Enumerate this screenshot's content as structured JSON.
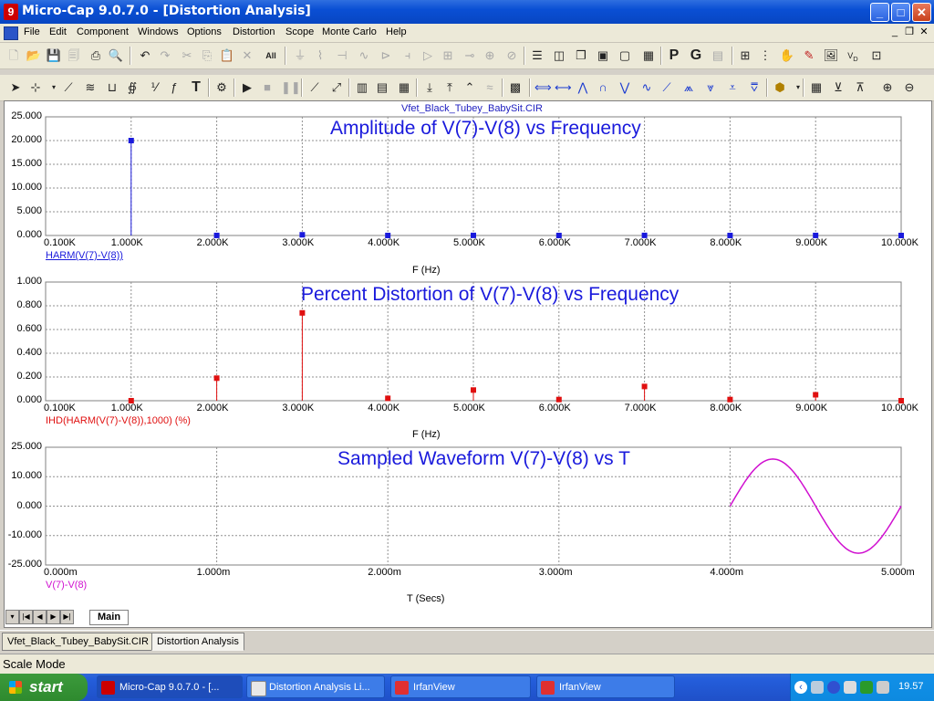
{
  "window": {
    "title": "Micro-Cap 9.0.7.0 - [Distortion Analysis]",
    "min": "_",
    "max": "□",
    "close": "✕"
  },
  "menu": [
    "File",
    "Edit",
    "Component",
    "Windows",
    "Options",
    "Distortion",
    "Scope",
    "Monte Carlo",
    "Help"
  ],
  "circuit_name": "Vfet_Black_Tubey_BabySit.CIR",
  "plots": [
    {
      "title": "Amplitude of V(7)-V(8) vs Frequency",
      "expression": "HARM(V(7)-V(8))",
      "expression_color": "#1a1adc",
      "xlabel": "F (Hz)",
      "y_ticks": [
        "25.000",
        "20.000",
        "15.000",
        "10.000",
        "5.000",
        "0.000"
      ],
      "x_ticks": [
        "0.100K",
        "1.000K",
        "2.000K",
        "3.000K",
        "4.000K",
        "5.000K",
        "6.000K",
        "7.000K",
        "8.000K",
        "9.000K",
        "10.000K"
      ]
    },
    {
      "title": "Percent Distortion of V(7)-V(8) vs Frequency",
      "expression": "IHD(HARM(V(7)-V(8)),1000) (%)",
      "expression_color": "#e01010",
      "xlabel": "F (Hz)",
      "y_ticks": [
        "1.000",
        "0.800",
        "0.600",
        "0.400",
        "0.200",
        "0.000"
      ],
      "x_ticks": [
        "0.100K",
        "1.000K",
        "2.000K",
        "3.000K",
        "4.000K",
        "5.000K",
        "6.000K",
        "7.000K",
        "8.000K",
        "9.000K",
        "10.000K"
      ]
    },
    {
      "title": "Sampled Waveform  V(7)-V(8) vs T",
      "expression": "V(7)-V(8)",
      "expression_color": "#d010d0",
      "xlabel": "T (Secs)",
      "y_ticks": [
        "25.000",
        "10.000",
        "0.000",
        "-10.000",
        "-25.000"
      ],
      "x_ticks": [
        "0.000m",
        "1.000m",
        "2.000m",
        "3.000m",
        "4.000m",
        "5.000m"
      ]
    }
  ],
  "chart_data": [
    {
      "type": "bar",
      "x": [
        1000,
        2000,
        3000,
        4000,
        5000,
        6000,
        7000,
        8000,
        9000,
        10000
      ],
      "values": [
        20.0,
        0.01,
        0.15,
        0.005,
        0.02,
        0.003,
        0.02,
        0.002,
        0.01,
        0.0
      ],
      "xlim": [
        0,
        10000
      ],
      "ylim": [
        0,
        25
      ],
      "color": "#1a1adc"
    },
    {
      "type": "bar",
      "x": [
        1000,
        2000,
        3000,
        4000,
        5000,
        6000,
        7000,
        8000,
        9000,
        10000
      ],
      "values": [
        0.0,
        0.19,
        0.74,
        0.02,
        0.09,
        0.01,
        0.12,
        0.01,
        0.05,
        0.0
      ],
      "xlim": [
        0,
        10000
      ],
      "ylim": [
        0,
        1
      ],
      "color": "#e01010"
    },
    {
      "type": "line",
      "x_units": "ms",
      "x": [
        4.0,
        4.1,
        4.2,
        4.25,
        4.3,
        4.4,
        4.5,
        4.6,
        4.7,
        4.75,
        4.8,
        4.9,
        5.0
      ],
      "values": [
        0.0,
        11.8,
        19.0,
        20.0,
        19.0,
        11.8,
        0.0,
        -11.8,
        -19.0,
        -20.0,
        -19.0,
        -11.8,
        0.0
      ],
      "xlim": [
        0,
        5
      ],
      "ylim": [
        -25,
        25
      ],
      "color": "#d010d0"
    }
  ],
  "tabs": {
    "main": "Main"
  },
  "doc_tabs": [
    "Vfet_Black_Tubey_BabySit.CIR",
    "Distortion Analysis"
  ],
  "status": "Scale Mode",
  "taskbar": {
    "start": "start",
    "items": [
      "Micro-Cap 9.0.7.0 - [...",
      "Distortion Analysis Li...",
      "IrfanView",
      "IrfanView"
    ],
    "clock": "19.57"
  },
  "icons": {
    "file_toolbar": [
      "new-file-icon",
      "open-icon",
      "save-icon",
      "save-all-icon",
      "print-icon",
      "print-preview-icon",
      "undo-icon",
      "redo-icon",
      "cut-icon",
      "copy-icon",
      "paste-icon",
      "delete-icon",
      "select-all-icon"
    ],
    "analysis_toolbar": [
      "select-arrow-icon",
      "run-icon",
      "stop-icon",
      "pause-icon",
      "zoom-in-icon",
      "zoom-out-icon"
    ]
  }
}
